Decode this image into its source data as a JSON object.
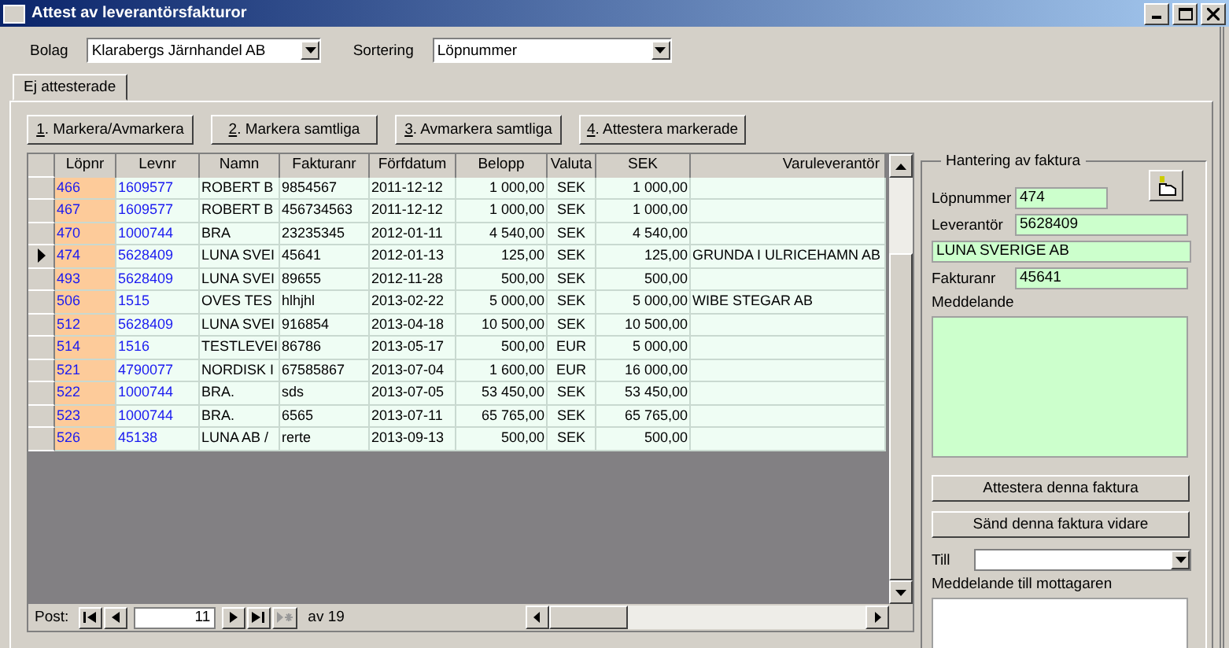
{
  "window": {
    "title": "Attest av leverantörsfakturor"
  },
  "filters": [
    {
      "label": "Bolag",
      "value": "Klarabergs  Järnhandel AB"
    },
    {
      "label": "Sortering",
      "value": "Löpnummer"
    }
  ],
  "tabs": [
    {
      "label": "Ej attesterade",
      "selected": true
    }
  ],
  "buttons": [
    {
      "key": "1",
      "label": ". Markera/Avmarkera"
    },
    {
      "key": "2",
      "label": ". Markera samtliga"
    },
    {
      "key": "3",
      "label": ". Avmarkera samtliga"
    },
    {
      "key": "4",
      "label": ". Attestera markerade"
    }
  ],
  "table": {
    "columns": [
      "Löpnr",
      "Levnr",
      "Namn",
      "Fakturanr",
      "Förfdatum",
      "Belopp",
      "Valuta",
      "SEK",
      "Varuleverantör"
    ],
    "rows": [
      {
        "current": false,
        "cells": [
          "466",
          "1609577",
          "ROBERT B",
          "9854567",
          "2011-12-12",
          "1 000,00",
          "SEK",
          "1 000,00",
          ""
        ]
      },
      {
        "current": false,
        "cells": [
          "467",
          "1609577",
          "ROBERT B",
          "456734563",
          "2011-12-12",
          "1 000,00",
          "SEK",
          "1 000,00",
          ""
        ]
      },
      {
        "current": false,
        "cells": [
          "470",
          "1000744",
          "BRA",
          "23235345",
          "2012-01-11",
          "4 540,00",
          "SEK",
          "4 540,00",
          ""
        ]
      },
      {
        "current": true,
        "cells": [
          "474",
          "5628409",
          "LUNA SVEI",
          "45641",
          "2012-01-13",
          "125,00",
          "SEK",
          "125,00",
          "GRUNDA I ULRICEHAMN AB"
        ]
      },
      {
        "current": false,
        "cells": [
          "493",
          "5628409",
          "LUNA SVEI",
          "89655",
          "2012-11-28",
          "500,00",
          "SEK",
          "500,00",
          ""
        ]
      },
      {
        "current": false,
        "cells": [
          "506",
          "1515",
          "OVES TES",
          "hlhjhl",
          "2013-02-22",
          "5 000,00",
          "SEK",
          "5 000,00",
          "WIBE STEGAR AB"
        ]
      },
      {
        "current": false,
        "cells": [
          "512",
          "5628409",
          "LUNA SVEI",
          "916854",
          "2013-04-18",
          "10 500,00",
          "SEK",
          "10 500,00",
          ""
        ]
      },
      {
        "current": false,
        "cells": [
          "514",
          "1516",
          "TESTLEVEI",
          "86786",
          "2013-05-17",
          "500,00",
          "EUR",
          "5 000,00",
          ""
        ]
      },
      {
        "current": false,
        "cells": [
          "521",
          "4790077",
          "NORDISK I",
          "67585867",
          "2013-07-04",
          "1 600,00",
          "EUR",
          "16 000,00",
          ""
        ]
      },
      {
        "current": false,
        "cells": [
          "522",
          "1000744",
          "BRA.",
          "sds",
          "2013-07-05",
          "53 450,00",
          "SEK",
          "53 450,00",
          ""
        ]
      },
      {
        "current": false,
        "cells": [
          "523",
          "1000744",
          "BRA.",
          "6565",
          "2013-07-11",
          "65 765,00",
          "SEK",
          "65 765,00",
          ""
        ]
      },
      {
        "current": false,
        "cells": [
          "526",
          "45138",
          "LUNA AB /",
          "rerte",
          "2013-09-13",
          "500,00",
          "SEK",
          "500,00",
          ""
        ]
      }
    ]
  },
  "navigator": {
    "label": "Post:",
    "current": "11",
    "of": "av  19"
  },
  "panel": {
    "title": "Hantering av faktura",
    "fields": [
      {
        "label": "Löpnummer",
        "value": "474"
      },
      {
        "label": "Leverantör",
        "value": "5628409"
      },
      {
        "value": "LUNA SVERIGE AB"
      },
      {
        "label": "Fakturanr",
        "value": "45641"
      }
    ],
    "message_label": "Meddelande",
    "actions": [
      "Attestera denna faktura",
      "Sänd denna faktura vidare"
    ],
    "to_label": "Till",
    "recipient_message_label": "Meddelande till mottagaren"
  }
}
